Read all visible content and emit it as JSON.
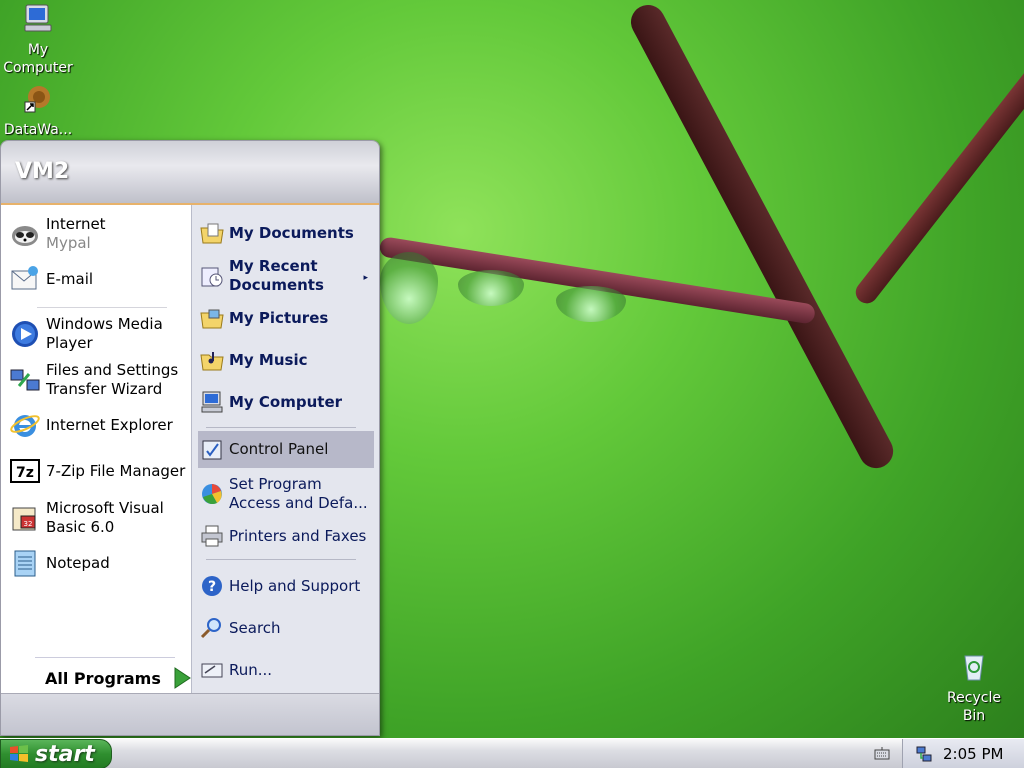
{
  "desktop": {
    "icons": [
      {
        "label": "My Computer",
        "icon": "my-computer-icon"
      },
      {
        "label": "DataWa...",
        "icon": "datawa-shortcut-icon"
      },
      {
        "label": "Recycle Bin",
        "icon": "recycle-bin-icon"
      }
    ]
  },
  "start_menu": {
    "user": "VM2",
    "left": {
      "pinned": [
        {
          "title": "Internet",
          "subtitle": "Mypal",
          "icon": "mypal-raccoon-icon"
        },
        {
          "title": "E-mail",
          "icon": "email-icon"
        }
      ],
      "recent": [
        {
          "line1": "Windows Media",
          "line2": "Player",
          "icon": "media-player-icon"
        },
        {
          "line1": "Files and Settings",
          "line2": "Transfer Wizard",
          "icon": "transfer-wizard-icon"
        },
        {
          "line1": "Internet Explorer",
          "icon": "internet-explorer-icon"
        },
        {
          "line1": "7-Zip File Manager",
          "icon": "7zip-icon"
        },
        {
          "line1": "Microsoft Visual",
          "line2": "Basic 6.0",
          "icon": "visual-basic-icon"
        },
        {
          "line1": "Notepad",
          "icon": "notepad-icon"
        }
      ],
      "all_programs": "All Programs"
    },
    "right": {
      "items": [
        {
          "line1": "My Documents",
          "icon": "folder-documents-icon"
        },
        {
          "line1": "My Recent",
          "line2": "Documents",
          "icon": "recent-documents-icon",
          "submenu": true
        },
        {
          "line1": "My Pictures",
          "icon": "folder-pictures-icon"
        },
        {
          "line1": "My Music",
          "icon": "folder-music-icon"
        },
        {
          "line1": "My Computer",
          "icon": "my-computer-icon"
        },
        {
          "line1": "Control Panel",
          "icon": "control-panel-icon"
        },
        {
          "line1": "Set Program",
          "line2": "Access and Defa...",
          "icon": "set-program-access-icon"
        },
        {
          "line1": "Printers and Faxes",
          "icon": "printer-icon"
        },
        {
          "line1": "Help and Support",
          "icon": "help-icon"
        },
        {
          "line1": "Search",
          "icon": "search-icon"
        },
        {
          "line1": "Run...",
          "icon": "run-icon"
        }
      ]
    }
  },
  "taskbar": {
    "start_label": "start",
    "clock": "2:05 PM"
  },
  "colors": {
    "start_green": "#2f8f2f",
    "menu_header": "#cfd0d8",
    "selected_item": "#b7b8c9"
  }
}
